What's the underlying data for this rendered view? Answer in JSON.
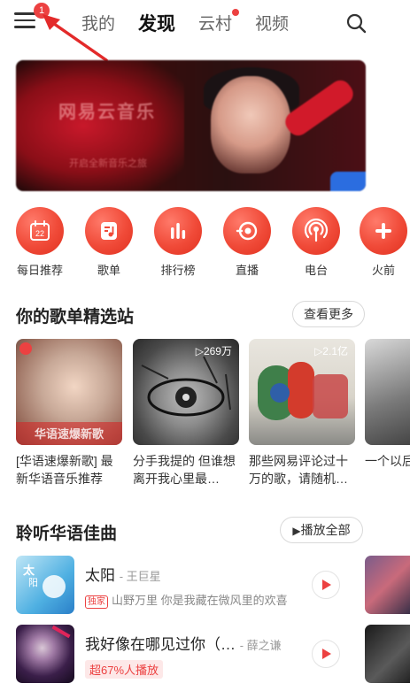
{
  "topnav": {
    "menu_badge": "1",
    "tabs": [
      {
        "label": "我的"
      },
      {
        "label": "发现"
      },
      {
        "label": "云村"
      },
      {
        "label": "视频"
      }
    ]
  },
  "banner": {
    "headline": "网易云音乐",
    "subline": "开启全新音乐之旅"
  },
  "quick_entries": [
    {
      "label": "每日推荐",
      "icon": "calendar-icon",
      "day": "22"
    },
    {
      "label": "歌单",
      "icon": "playlist-icon"
    },
    {
      "label": "排行榜",
      "icon": "chart-bars-icon"
    },
    {
      "label": "直播",
      "icon": "live-icon"
    },
    {
      "label": "电台",
      "icon": "radio-icon"
    },
    {
      "label": "火前",
      "icon": "fire-icon"
    }
  ],
  "playlists_section": {
    "title": "你的歌单精选站",
    "more_label": "查看更多",
    "items": [
      {
        "title": "[华语速爆新歌] 最新华语音乐推荐",
        "cover_text": "华语速爆新歌",
        "count": ""
      },
      {
        "title": "分手我提的 但谁想离开我心里最…",
        "count": "▷269万"
      },
      {
        "title": "那些网易评论过十万的歌，请随机…",
        "count": "▷2.1亿"
      },
      {
        "title": "一个以后",
        "count": ""
      }
    ]
  },
  "songs_section": {
    "title": "聆听华语佳曲",
    "play_all_label": "播放全部",
    "songs": [
      {
        "name": "太阳",
        "artist": "- 王巨星",
        "tag": "独家",
        "desc": "山野万里 你是我藏在微风里的欢喜"
      },
      {
        "name": "我好像在哪见过你（…",
        "artist": "- 薛之谦",
        "hot": "超67%人播放"
      }
    ]
  },
  "colors": {
    "accent": "#ec4141"
  }
}
